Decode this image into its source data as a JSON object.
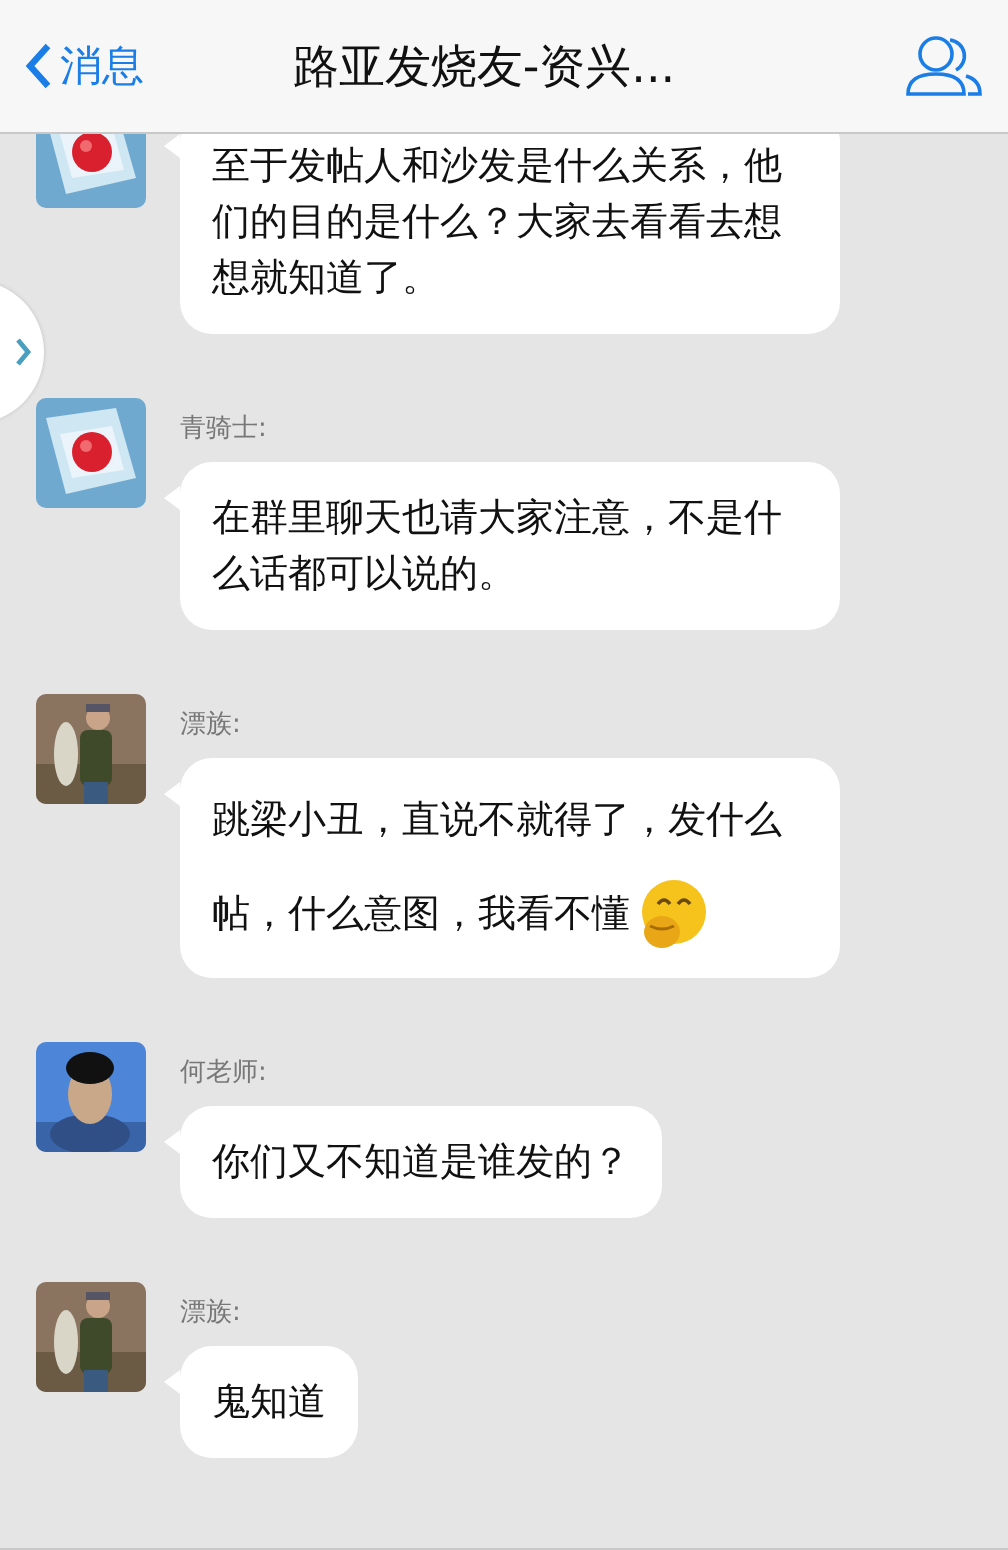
{
  "nav": {
    "back": "消息",
    "title": "路亚发烧友-资兴..."
  },
  "messages": [
    {
      "text": "至于发帖人和沙发是什么关系，他们的目的是什么？大家去看看去想想就知道了。",
      "emoji": false
    },
    {
      "sender": "青骑士:",
      "text": "在群里聊天也请大家注意，不是什么话都可以说的。",
      "emoji": false
    },
    {
      "sender": "漂族:",
      "text": "跳梁小丑，直说不就得了，发什么帖，什么意图，我看不懂",
      "emoji": true
    },
    {
      "sender": "何老师:",
      "text": "你们又不知道是谁发的？",
      "emoji": false
    },
    {
      "sender": "漂族:",
      "text": "鬼知道",
      "emoji": false
    }
  ]
}
